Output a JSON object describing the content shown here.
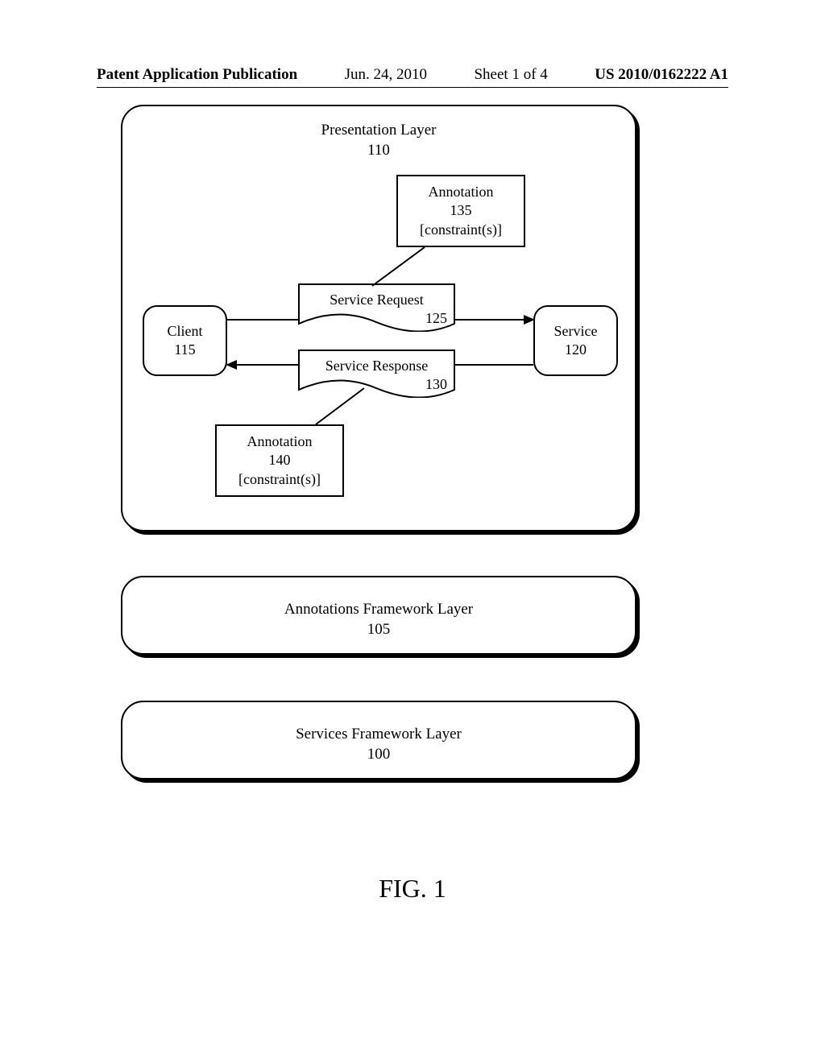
{
  "header": {
    "publication": "Patent Application Publication",
    "date": "Jun. 24, 2010",
    "sheet": "Sheet 1 of 4",
    "pubnum": "US 2010/0162222 A1"
  },
  "figure": {
    "label": "FIG. 1"
  },
  "presentation": {
    "title": "Presentation Layer",
    "num": "110"
  },
  "annotations_layer": {
    "title": "Annotations Framework Layer",
    "num": "105"
  },
  "services_layer": {
    "title": "Services Framework Layer",
    "num": "100"
  },
  "client": {
    "label": "Client",
    "num": "115"
  },
  "service": {
    "label": "Service",
    "num": "120"
  },
  "service_request": {
    "label": "Service Request",
    "num": "125"
  },
  "service_response": {
    "label": "Service Response",
    "num": "130"
  },
  "annotation_135": {
    "label": "Annotation",
    "num": "135",
    "constraint": "[constraint(s)]"
  },
  "annotation_140": {
    "label": "Annotation",
    "num": "140",
    "constraint": "[constraint(s)]"
  }
}
